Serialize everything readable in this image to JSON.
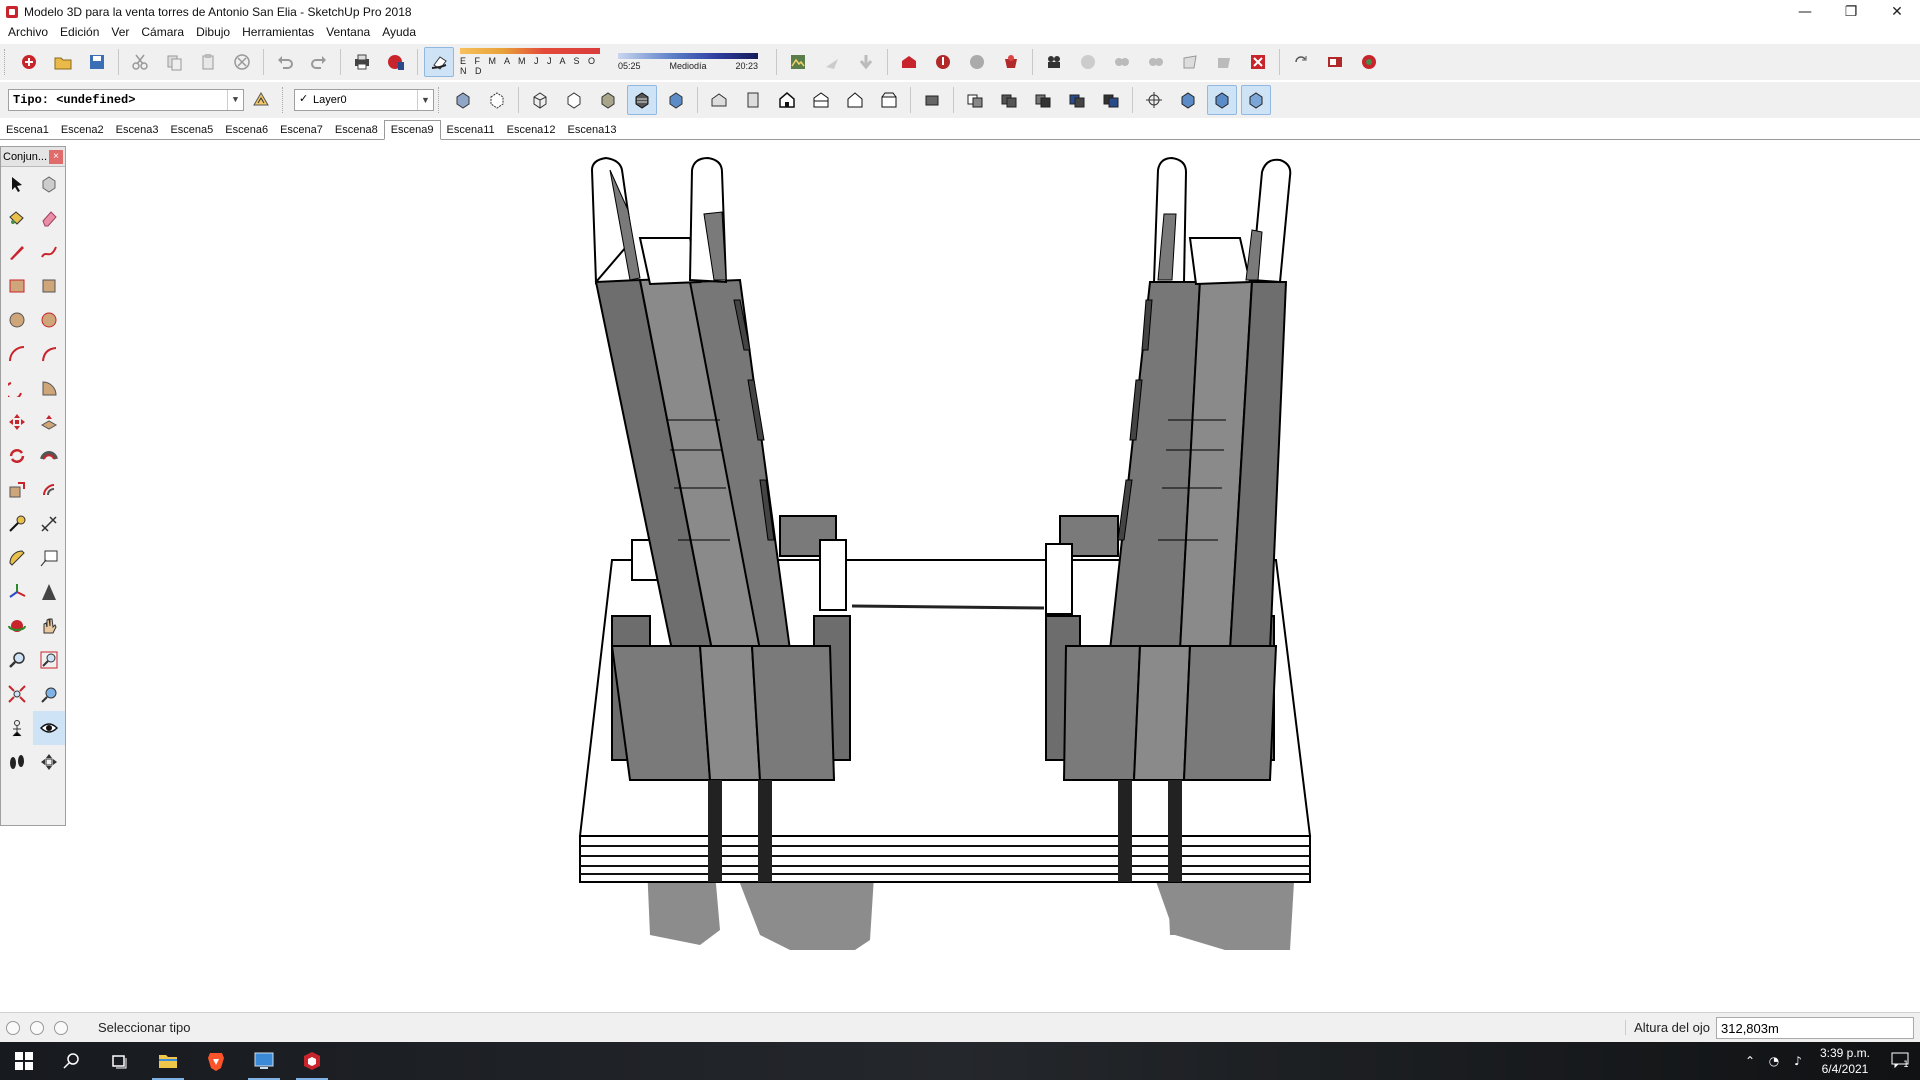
{
  "window": {
    "title": "Modelo 3D para la venta torres de Antonio San Elia - SketchUp Pro 2018",
    "minimize": "—",
    "maximize": "❐",
    "close": "✕"
  },
  "menu": [
    "Archivo",
    "Edición",
    "Ver",
    "Cámara",
    "Dibujo",
    "Herramientas",
    "Ventana",
    "Ayuda"
  ],
  "shadows": {
    "months": "E F M A M J J A S O N D",
    "sunrise": "05:25",
    "noon": "Mediodía",
    "sunset": "20:23"
  },
  "toolbar2": {
    "tipo_value": "Tipo: <undefined>",
    "layer_value": "Layer0"
  },
  "scenes": [
    "Escena1",
    "Escena2",
    "Escena3",
    "Escena5",
    "Escena6",
    "Escena7",
    "Escena8",
    "Escena9",
    "Escena11",
    "Escena12",
    "Escena13"
  ],
  "active_scene": "Escena9",
  "panel": {
    "title": "Conjun...",
    "close": "×"
  },
  "status": {
    "text": "Seleccionar tipo",
    "measure_label": "Altura del ojo",
    "measure_value": "312,803m"
  },
  "taskbar": {
    "time": "3:39 p.m.",
    "date": "6/4/2021",
    "notif_count": "1"
  },
  "colors": {
    "accent": "#c8242b",
    "tool_active": "#cfe3f7",
    "tower_face": "#7c7c7c",
    "shadow": "#8c8c8c"
  }
}
